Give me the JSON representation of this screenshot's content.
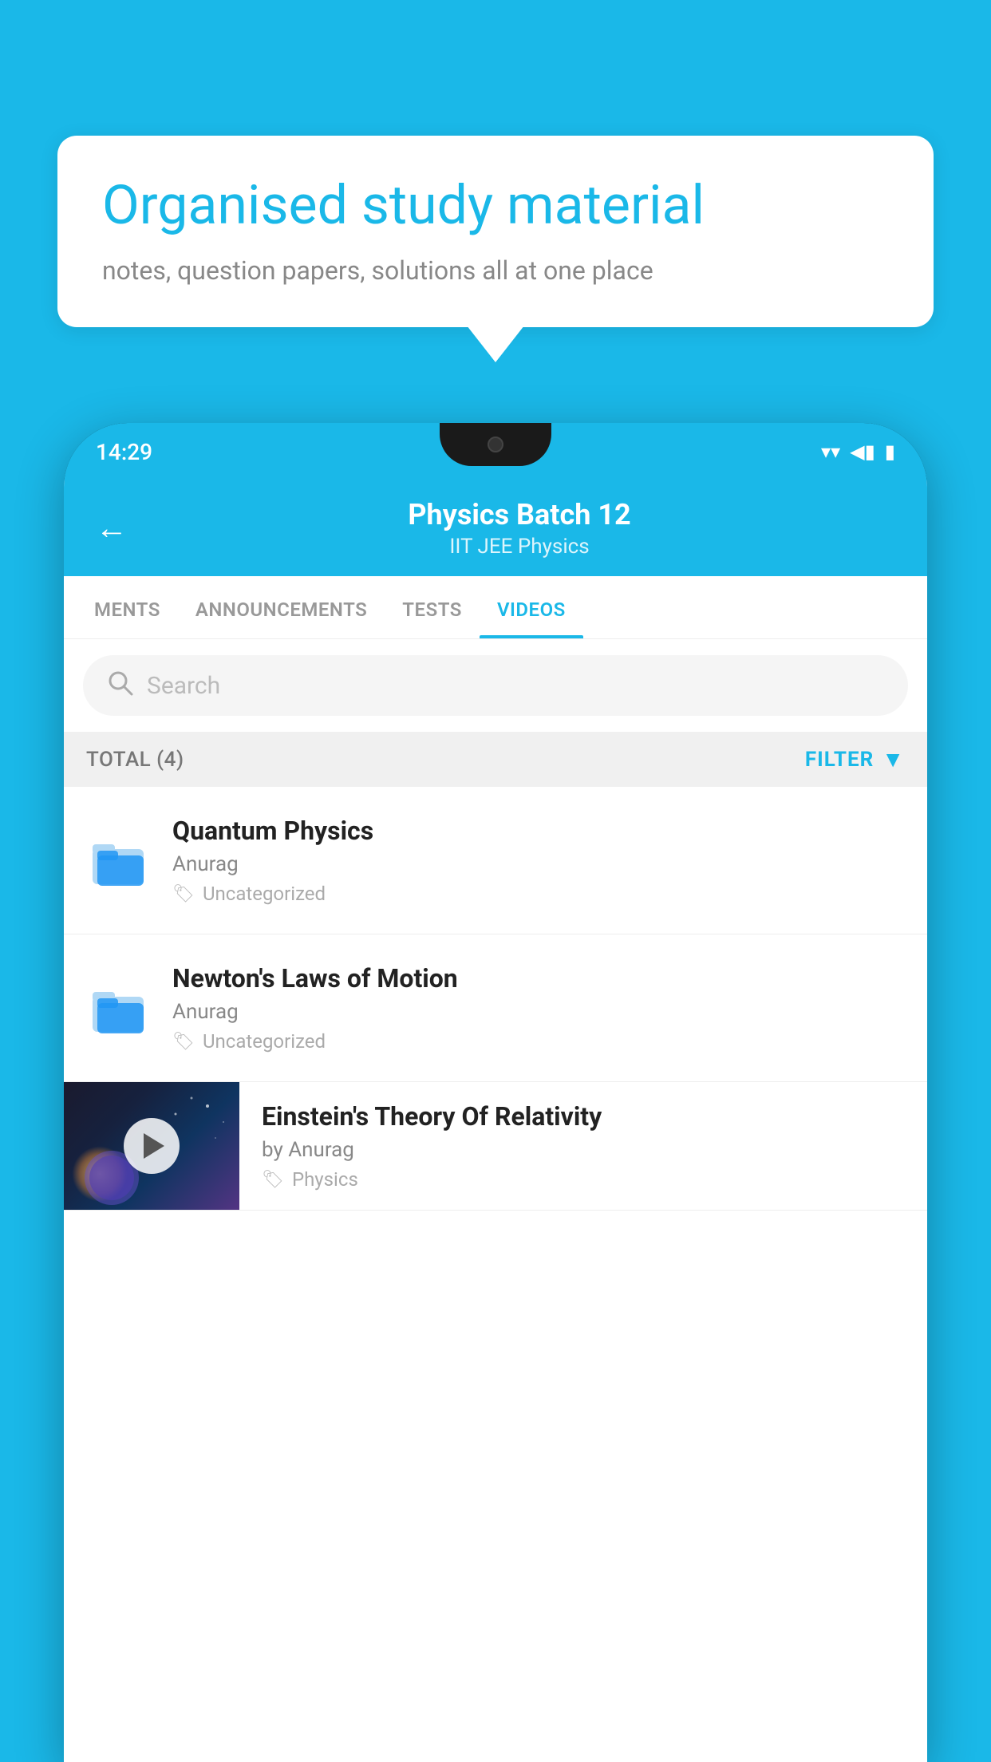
{
  "app": {
    "background_color": "#1ab8e8"
  },
  "speech_bubble": {
    "title": "Organised study material",
    "subtitle": "notes, question papers, solutions all at one place"
  },
  "status_bar": {
    "time": "14:29",
    "icons": [
      "▼",
      "◀",
      "▮"
    ]
  },
  "header": {
    "back_label": "←",
    "title": "Physics Batch 12",
    "subtitle_tags": "IIT JEE    Physics"
  },
  "tabs": [
    {
      "label": "MENTS",
      "active": false
    },
    {
      "label": "ANNOUNCEMENTS",
      "active": false
    },
    {
      "label": "TESTS",
      "active": false
    },
    {
      "label": "VIDEOS",
      "active": true
    }
  ],
  "search": {
    "placeholder": "Search"
  },
  "filter_bar": {
    "total_label": "TOTAL (4)",
    "filter_label": "FILTER"
  },
  "video_items": [
    {
      "id": 1,
      "type": "folder",
      "title": "Quantum Physics",
      "author": "Anurag",
      "tag": "Uncategorized"
    },
    {
      "id": 2,
      "type": "folder",
      "title": "Newton's Laws of Motion",
      "author": "Anurag",
      "tag": "Uncategorized"
    },
    {
      "id": 3,
      "type": "video",
      "title": "Einstein's Theory Of Relativity",
      "author": "by Anurag",
      "tag": "Physics"
    }
  ]
}
